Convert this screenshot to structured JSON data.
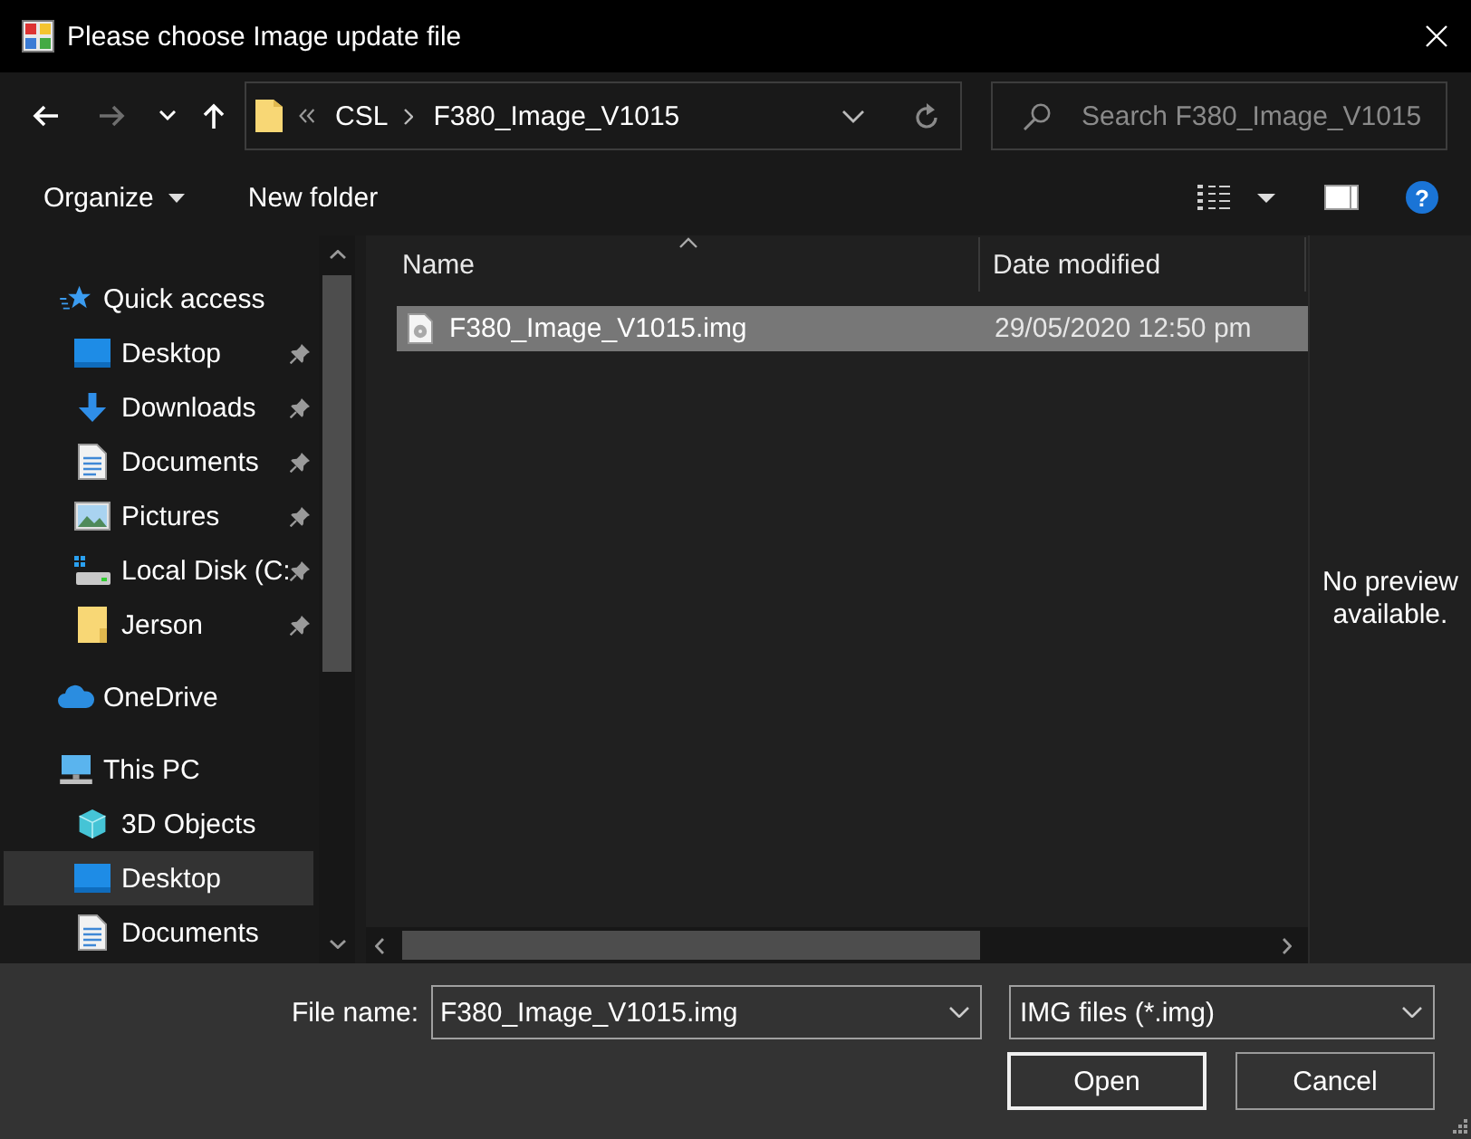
{
  "window": {
    "title": "Please choose Image update file"
  },
  "navigation": {
    "back": {
      "disabled": false
    },
    "forward": {
      "disabled": true
    }
  },
  "address_bar": {
    "path": [
      "CSL",
      "F380_Image_V1015"
    ]
  },
  "search": {
    "placeholder": "Search F380_Image_V1015"
  },
  "toolbar": {
    "organize": "Organize",
    "new_folder": "New folder",
    "help": "?"
  },
  "sidebar": {
    "items": [
      {
        "kind": "quickaccess",
        "label": "Quick access",
        "pinned": false,
        "selected": false,
        "children": [
          {
            "kind": "desktop",
            "label": "Desktop",
            "pinned": true,
            "selected": false
          },
          {
            "kind": "downloads",
            "label": "Downloads",
            "pinned": true,
            "selected": false
          },
          {
            "kind": "documents",
            "label": "Documents",
            "pinned": true,
            "selected": false
          },
          {
            "kind": "pictures",
            "label": "Pictures",
            "pinned": true,
            "selected": false
          },
          {
            "kind": "disk",
            "label": "Local Disk (C:",
            "pinned": true,
            "selected": false
          },
          {
            "kind": "folder",
            "label": "Jerson",
            "pinned": true,
            "selected": false
          }
        ]
      },
      {
        "kind": "cloud",
        "label": "OneDrive",
        "pinned": false,
        "selected": false
      },
      {
        "kind": "computer",
        "label": "This PC",
        "pinned": false,
        "selected": false,
        "children": [
          {
            "kind": "objects",
            "label": "3D Objects",
            "pinned": false,
            "selected": false
          },
          {
            "kind": "desktop",
            "label": "Desktop",
            "pinned": false,
            "selected": true
          },
          {
            "kind": "documents",
            "label": "Documents",
            "pinned": false,
            "selected": false
          }
        ]
      }
    ]
  },
  "file_list": {
    "columns": [
      {
        "label": "Name",
        "sorted": true
      },
      {
        "label": "Date modified",
        "sorted": false
      }
    ],
    "rows": [
      {
        "name": "F380_Image_V1015.img",
        "date_modified": "29/05/2020 12:50 pm",
        "selected": true
      }
    ]
  },
  "preview": {
    "message": "No preview available."
  },
  "footer": {
    "file_name_label": "File name:",
    "file_name": "F380_Image_V1015.img",
    "file_type": "IMG files (*.img)",
    "buttons": [
      {
        "label": "Open",
        "default": true
      },
      {
        "label": "Cancel",
        "default": false
      }
    ]
  }
}
